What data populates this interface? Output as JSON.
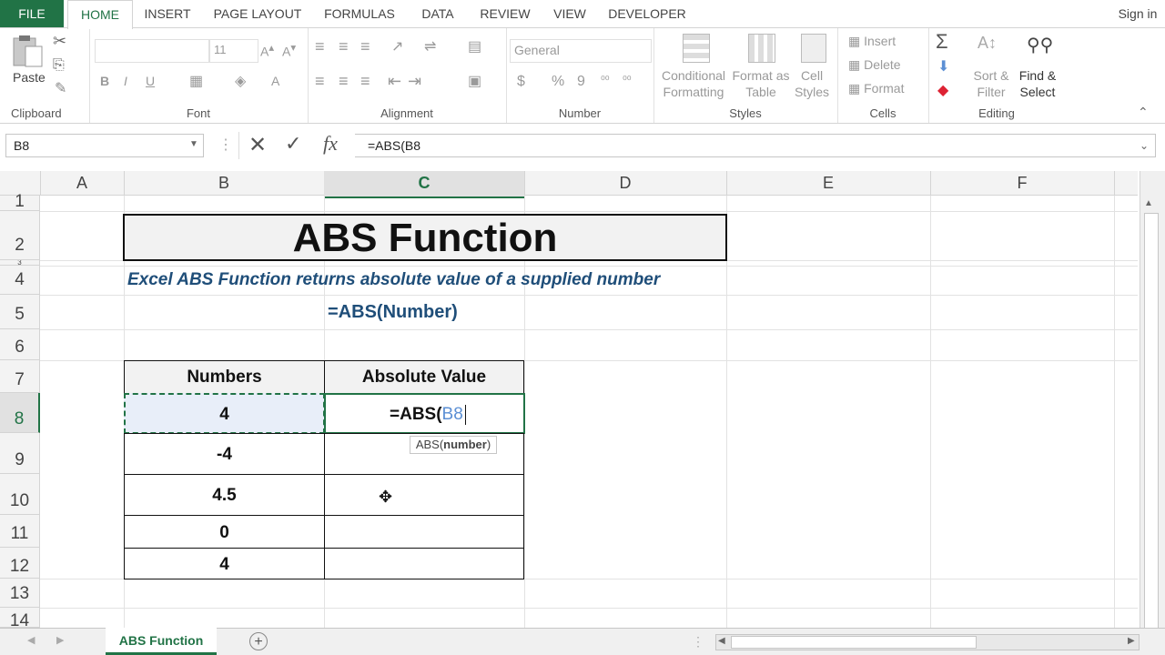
{
  "tabs": [
    "FILE",
    "HOME",
    "INSERT",
    "PAGE LAYOUT",
    "FORMULAS",
    "DATA",
    "REVIEW",
    "VIEW",
    "DEVELOPER"
  ],
  "signin": "Sign in",
  "ribbon": {
    "clipboard": {
      "label": "Clipboard",
      "paste": "Paste"
    },
    "font": {
      "label": "Font",
      "size": "11",
      "bold": "B",
      "italic": "I",
      "underline": "U"
    },
    "alignment": {
      "label": "Alignment"
    },
    "number": {
      "label": "Number",
      "format": "General",
      "currency": "$",
      "percent": "%",
      "comma": "9"
    },
    "styles": {
      "label": "Styles",
      "conditional": "Conditional",
      "formatting": "Formatting",
      "format_as": "Format as",
      "table": "Table",
      "cell": "Cell",
      "cell_styles": "Styles"
    },
    "cells": {
      "label": "Cells",
      "insert": "Insert",
      "delete": "Delete",
      "format": "Format"
    },
    "editing": {
      "label": "Editing",
      "sort": "Sort &",
      "filter": "Filter",
      "find": "Find &",
      "select": "Select"
    }
  },
  "formula_bar": {
    "name_box": "B8",
    "fx": "fx",
    "formula": "=ABS(B8"
  },
  "columns": [
    "A",
    "B",
    "C",
    "D",
    "E",
    "F"
  ],
  "rows": [
    "1",
    "2",
    "3",
    "4",
    "5",
    "6",
    "7",
    "8",
    "9",
    "10",
    "11",
    "12",
    "13",
    "14"
  ],
  "sheet": {
    "title": "ABS Function",
    "description": "Excel ABS Function returns absolute value of a supplied number",
    "syntax": "=ABS(Number)",
    "table_headers": [
      "Numbers",
      "Absolute Value"
    ],
    "numbers": [
      "4",
      "-4",
      "4.5",
      "0",
      "4"
    ],
    "edit_prefix": "=ABS(",
    "edit_ref": "B8",
    "tooltip_fn": "ABS(",
    "tooltip_arg": "number",
    "tooltip_close": ")"
  },
  "sheet_tab": "ABS Function",
  "colors": {
    "accent": "#217346",
    "ref_blue": "#5b8fd4",
    "description_blue": "#1f4e79",
    "title_bg": "#f2f2f2"
  }
}
